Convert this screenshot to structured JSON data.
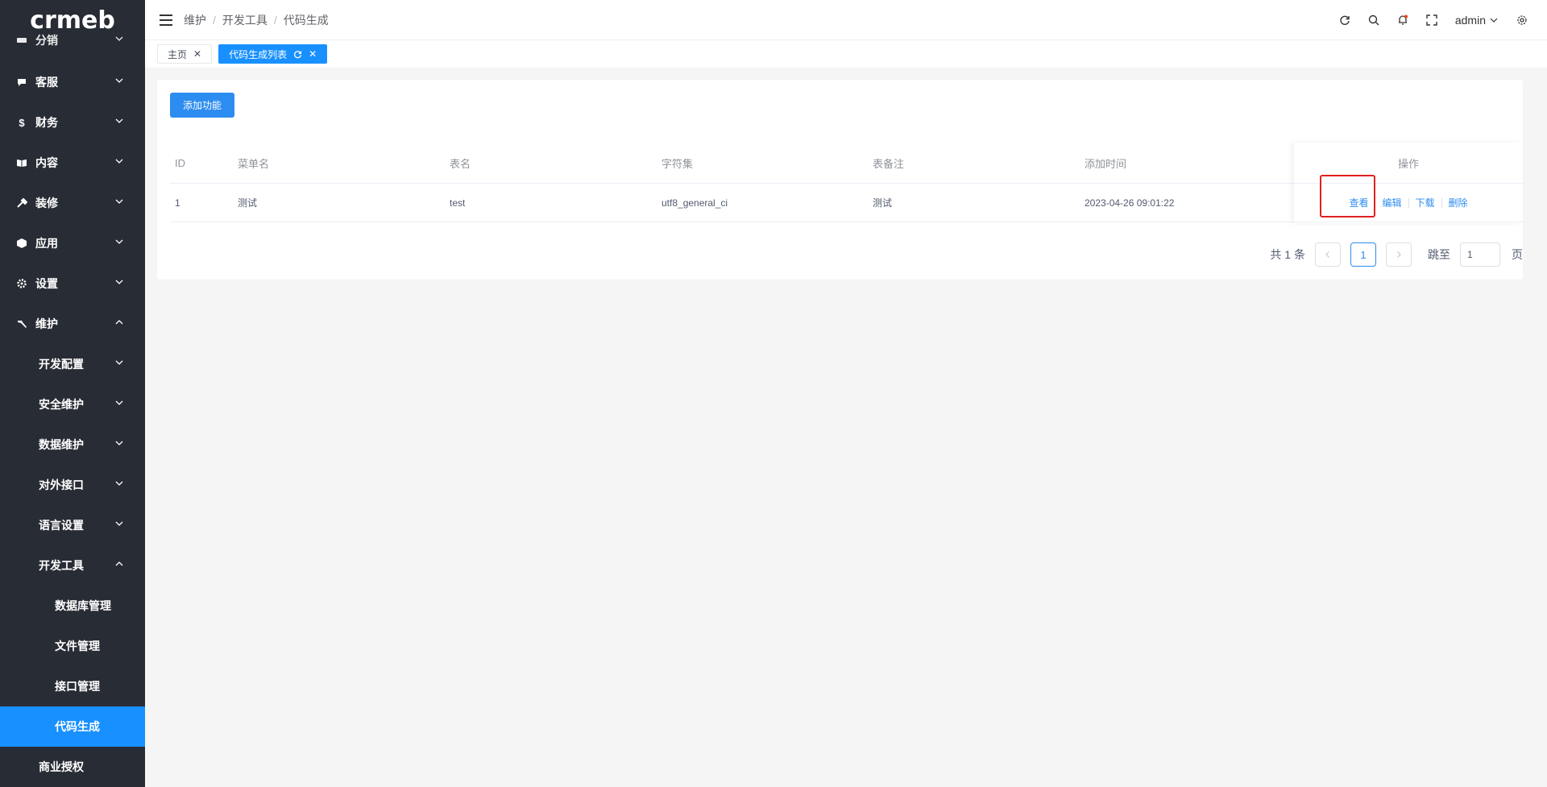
{
  "logo": "crmeb",
  "sidebar": {
    "items": [
      {
        "label": "分销",
        "icon": "users-icon",
        "expanded": false
      },
      {
        "label": "客服",
        "icon": "chat-icon",
        "expanded": false
      },
      {
        "label": "财务",
        "icon": "dollar-icon",
        "expanded": false
      },
      {
        "label": "内容",
        "icon": "book-icon",
        "expanded": false
      },
      {
        "label": "装修",
        "icon": "tools-icon",
        "expanded": false
      },
      {
        "label": "应用",
        "icon": "cube-icon",
        "expanded": false
      },
      {
        "label": "设置",
        "icon": "gear-icon",
        "expanded": false
      },
      {
        "label": "维护",
        "icon": "hammer-icon",
        "expanded": true
      }
    ],
    "sub_items": [
      {
        "label": "开发配置",
        "expanded": false
      },
      {
        "label": "安全维护",
        "expanded": false
      },
      {
        "label": "数据维护",
        "expanded": false
      },
      {
        "label": "对外接口",
        "expanded": false
      },
      {
        "label": "语言设置",
        "expanded": false
      },
      {
        "label": "开发工具",
        "expanded": true
      }
    ],
    "leaf_items": [
      {
        "label": "数据库管理"
      },
      {
        "label": "文件管理"
      },
      {
        "label": "接口管理"
      },
      {
        "label": "代码生成",
        "active": true
      }
    ],
    "bottom_item": {
      "label": "商业授权"
    }
  },
  "header": {
    "breadcrumb": [
      "维护",
      "开发工具",
      "代码生成"
    ],
    "separator": "/",
    "user": "admin"
  },
  "tabs": [
    {
      "label": "主页",
      "active": false
    },
    {
      "label": "代码生成列表",
      "active": true
    }
  ],
  "toolbar": {
    "add_label": "添加功能"
  },
  "table": {
    "columns": [
      "ID",
      "菜单名",
      "表名",
      "字符集",
      "表备注",
      "添加时间",
      "操作"
    ],
    "rows": [
      {
        "id": "1",
        "menu": "测试",
        "table": "test",
        "charset": "utf8_general_ci",
        "remark": "测试",
        "time": "2023-04-26 09:01:22"
      }
    ],
    "actions": [
      "查看",
      "编辑",
      "下载",
      "删除"
    ]
  },
  "pagination": {
    "total_text": "共 1 条",
    "current_page": "1",
    "jump_label": "跳至",
    "jump_value": "1",
    "page_suffix": "页"
  },
  "colors": {
    "sidebar_bg": "#282c34",
    "accent": "#1890ff",
    "link": "#2d8cf0",
    "highlight": "#e02020"
  }
}
